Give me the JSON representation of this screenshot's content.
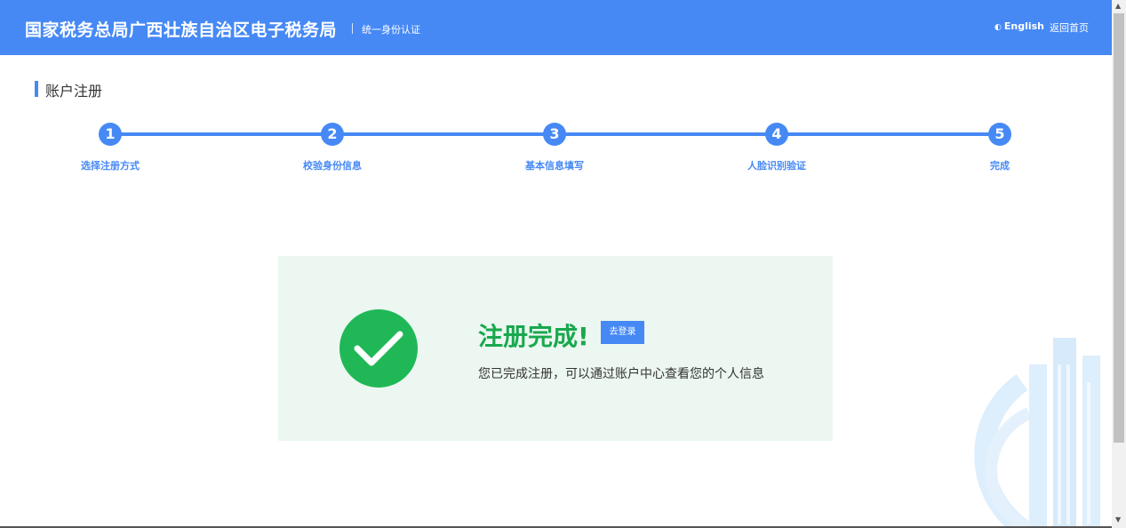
{
  "header": {
    "brand": "国家税务总局广西壮族自治区电子税务局",
    "subtitle": "统一身份认证",
    "lang_label": "English",
    "home_label": "返回首页"
  },
  "page": {
    "title": "账户注册"
  },
  "steps": [
    {
      "number": "1",
      "label": "选择注册方式"
    },
    {
      "number": "2",
      "label": "校验身份信息"
    },
    {
      "number": "3",
      "label": "基本信息填写"
    },
    {
      "number": "4",
      "label": "人脸识别验证"
    },
    {
      "number": "5",
      "label": "完成"
    }
  ],
  "success": {
    "title": "注册完成!",
    "login_button": "去登录",
    "description": "您已完成注册，可以通过账户中心查看您的个人信息"
  },
  "colors": {
    "primary": "#4689f5",
    "success": "#20b857",
    "success_bg": "#ebf7f0"
  },
  "icons": {
    "check": "check-icon",
    "language": "language-icon"
  }
}
